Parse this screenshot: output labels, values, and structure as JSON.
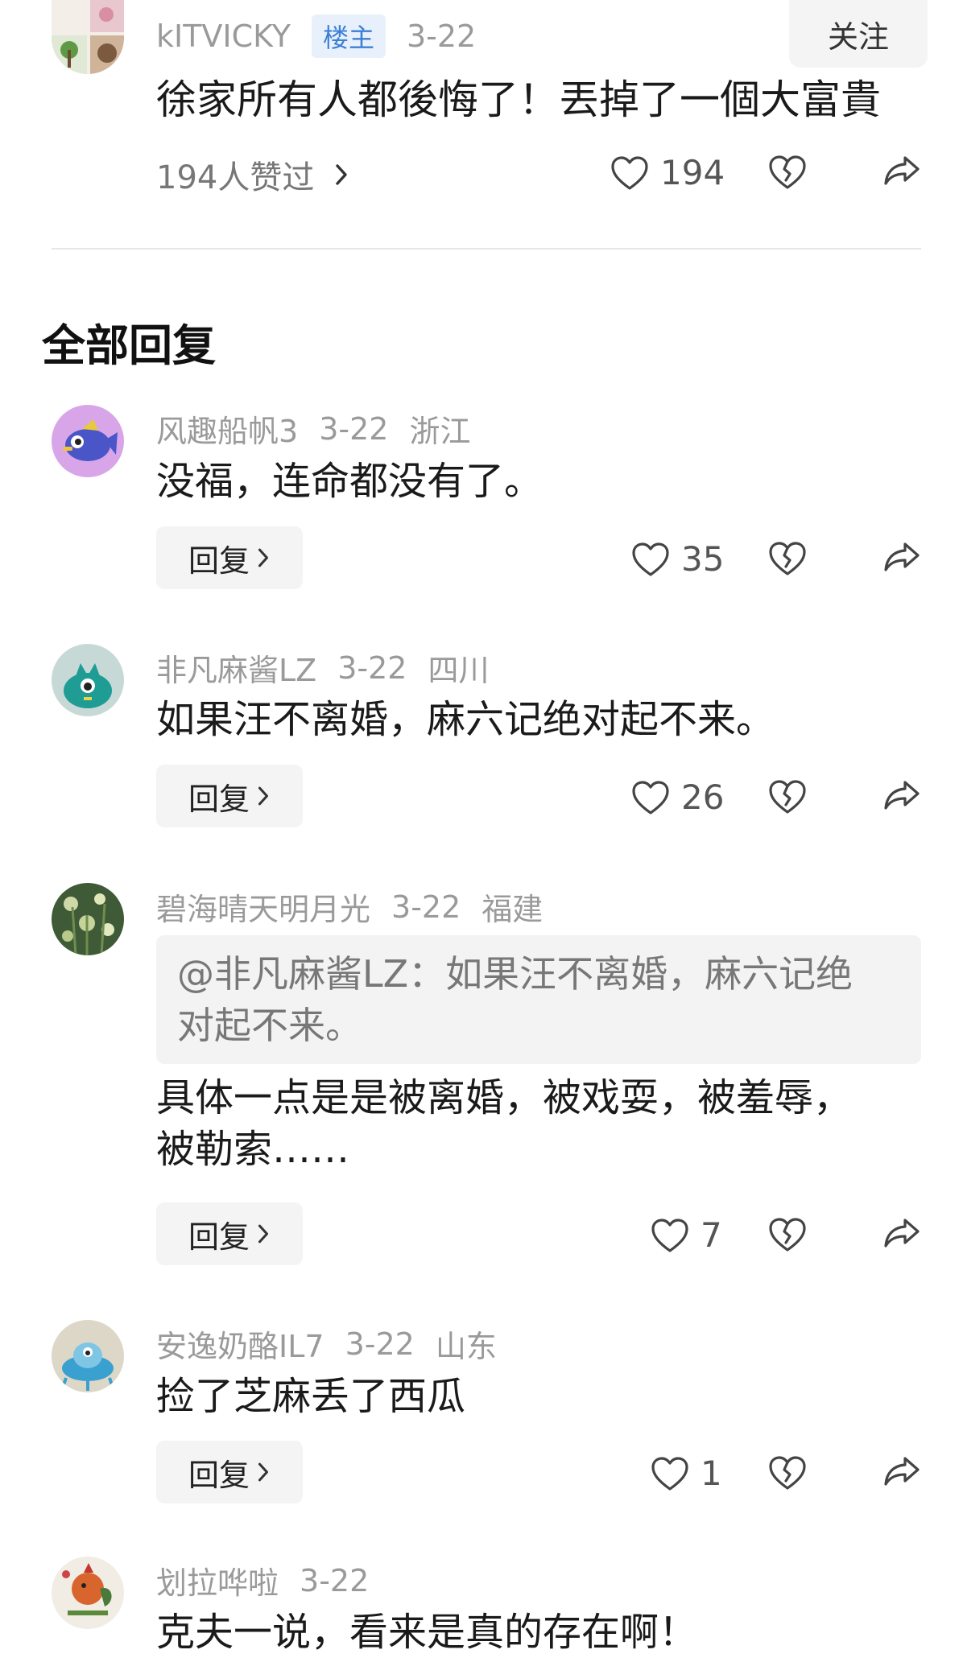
{
  "op": {
    "username": "kITVICKY",
    "badge": "楼主",
    "date": "3-22",
    "follow_label": "关注",
    "text": "徐家所有人都後悔了！丟掉了一個大富貴",
    "liked_by": "194人赞过",
    "like_count": "194"
  },
  "section_title": "全部回复",
  "reply_label": "回复",
  "comments": [
    {
      "name": "风趣船帆3",
      "date": "3-22",
      "location": "浙江",
      "text": "没福，连命都没有了。",
      "likes": "35"
    },
    {
      "name": "非凡麻酱LZ",
      "date": "3-22",
      "location": "四川",
      "text": "如果汪不离婚，麻六记绝对起不来。",
      "likes": "26"
    },
    {
      "name": "碧海晴天明月光",
      "date": "3-22",
      "location": "福建",
      "quote_line1": "@非凡麻酱LZ：如果汪不离婚，麻六记绝",
      "quote_line2": "对起不来。",
      "text_line1": "具体一点是是被离婚，被戏耍，被羞辱，",
      "text_line2": "被勒索……",
      "likes": "7"
    },
    {
      "name": "安逸奶酪IL7",
      "date": "3-22",
      "location": "山东",
      "text": "捡了芝麻丢了西瓜",
      "likes": "1"
    },
    {
      "name": "划拉哗啦",
      "date": "3-22",
      "text": "克夫一说，看来是真的存在啊！"
    }
  ],
  "colors": {
    "meta": "#9a9a9a",
    "badge_bg": "#e8f1fb",
    "badge_text": "#3d7fd6",
    "button_bg": "#f4f4f4"
  }
}
